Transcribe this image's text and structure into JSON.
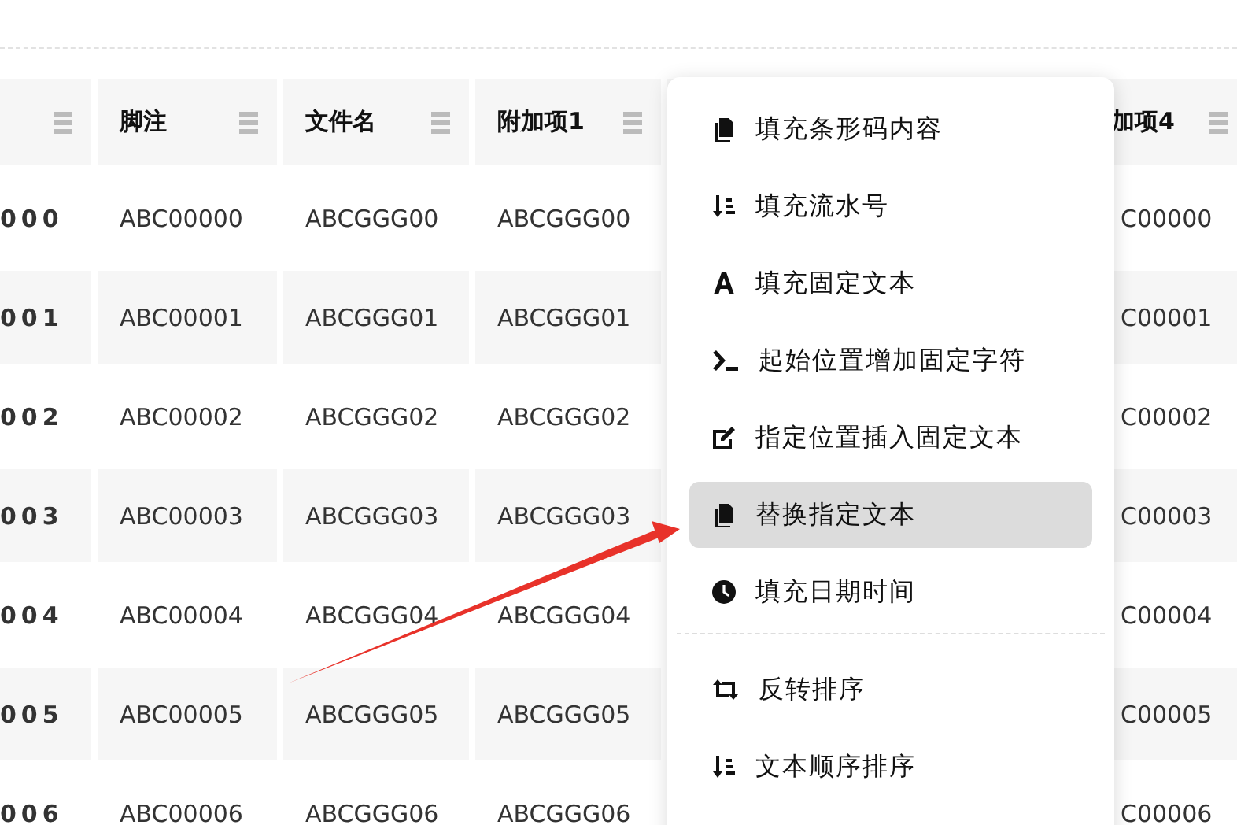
{
  "table": {
    "columns": [
      {},
      {
        "label": "脚注"
      },
      {
        "label": "文件名"
      },
      {
        "label": "附加项1"
      },
      {
        "label": "加项4"
      }
    ],
    "rows": [
      [
        "000",
        "ABC00000",
        "ABCGGG00",
        "ABCGGG00",
        "C00000"
      ],
      [
        "001",
        "ABC00001",
        "ABCGGG01",
        "ABCGGG01",
        "C00001"
      ],
      [
        "002",
        "ABC00002",
        "ABCGGG02",
        "ABCGGG02",
        "C00002"
      ],
      [
        "003",
        "ABC00003",
        "ABCGGG03",
        "ABCGGG03",
        "C00003"
      ],
      [
        "004",
        "ABC00004",
        "ABCGGG04",
        "ABCGGG04",
        "C00004"
      ],
      [
        "005",
        "ABC00005",
        "ABCGGG05",
        "ABCGGG05",
        "C00005"
      ],
      [
        "006",
        "ABC00006",
        "ABCGGG06",
        "ABCGGG06",
        "C00006"
      ]
    ]
  },
  "menu": {
    "sections": [
      {
        "items": [
          {
            "label": "填充条形码内容",
            "selected": false
          },
          {
            "label": "填充流水号",
            "selected": false
          },
          {
            "label": "填充固定文本",
            "selected": false
          },
          {
            "label": "起始位置增加固定字符",
            "selected": false
          },
          {
            "label": "指定位置插入固定文本",
            "selected": false
          },
          {
            "label": "替换指定文本",
            "selected": true
          },
          {
            "label": "填充日期时间",
            "selected": false
          }
        ]
      },
      {
        "items": [
          {
            "label": "反转排序",
            "selected": false
          },
          {
            "label": "文本顺序排序",
            "selected": false
          }
        ]
      }
    ]
  }
}
